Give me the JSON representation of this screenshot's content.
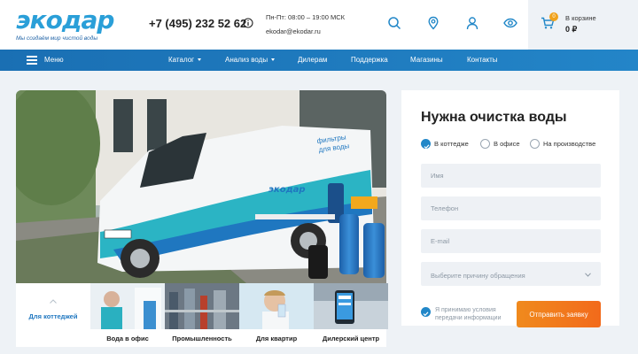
{
  "header": {
    "logo_text": "экодар",
    "logo_tagline": "Мы создаём мир чистой воды",
    "phone": "+7 (495) 232 52 62",
    "hours": "Пн-Пт: 08:00 – 19:00 МСК",
    "email": "ekodar@ekodar.ru",
    "icons": [
      "info-icon",
      "search-icon",
      "location-icon",
      "user-icon",
      "eye-icon",
      "cart-icon"
    ],
    "cart": {
      "title": "В корзине",
      "sum": "0 ₽",
      "count": "0"
    }
  },
  "nav": {
    "menu_label": "Меню",
    "items": [
      {
        "label": "Каталог",
        "dropdown": true
      },
      {
        "label": "Анализ воды",
        "dropdown": true
      },
      {
        "label": "Дилерам",
        "dropdown": false
      },
      {
        "label": "Поддержка",
        "dropdown": false
      },
      {
        "label": "Магазины",
        "dropdown": false
      },
      {
        "label": "Контакты",
        "dropdown": false
      }
    ]
  },
  "hero": {
    "van_text_1": "фильтры",
    "van_text_2": "для воды",
    "van_logo": "экодар"
  },
  "categories": [
    {
      "label": "Для коттеджей",
      "active": true
    },
    {
      "label": "Вода в офис",
      "active": false
    },
    {
      "label": "Промышленность",
      "active": false
    },
    {
      "label": "Для квартир",
      "active": false
    },
    {
      "label": "Дилерский центр",
      "active": false
    }
  ],
  "form": {
    "title": "Нужна очистка воды",
    "radios": [
      {
        "label": "В коттедже",
        "checked": true
      },
      {
        "label": "В офисе",
        "checked": false
      },
      {
        "label": "На производстве",
        "checked": false
      }
    ],
    "name_placeholder": "Имя",
    "phone_placeholder": "Телефон",
    "email_placeholder": "E-mail",
    "reason_placeholder": "Выберите причину обращения",
    "consent_text": "Я принимаю условия передачи информации",
    "submit_label": "Отправить заявку"
  },
  "colors": {
    "brand_blue": "#1f77c0",
    "accent_orange": "#f26a1b",
    "page_bg": "#eef2f6"
  }
}
